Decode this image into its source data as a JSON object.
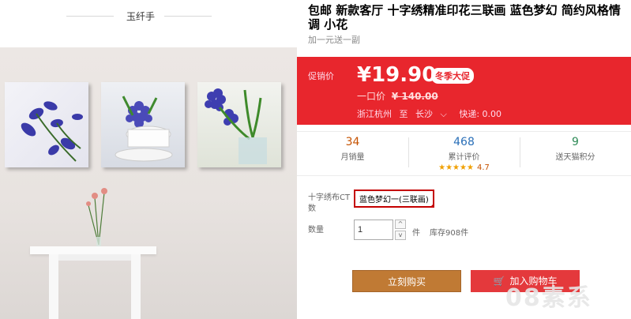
{
  "left": {
    "brand_name": "玉纤手"
  },
  "product": {
    "title": "包邮 新款客厅 十字绣精准印花三联画 蓝色梦幻 简约风格情调 小花",
    "subtitle": "加一元送一副"
  },
  "price": {
    "promo_label": "促销价",
    "current": "¥19.90",
    "promo_badge": "冬季大促",
    "orig_label": "一口价",
    "orig_value": "¥ 140.00",
    "ship_from": "浙江杭州",
    "to_label": "至",
    "ship_to": "长沙",
    "shipping": "快递: 0.00"
  },
  "stats": [
    {
      "value": "34",
      "label": "月销量"
    },
    {
      "value": "468",
      "label": "累计评价",
      "stars": "★★★★★",
      "score": "4.7"
    },
    {
      "value": "9",
      "label": "送天猫积分"
    }
  ],
  "options": {
    "label": "十字绣布CT数",
    "selected": "蓝色梦幻一(三联画)"
  },
  "quantity": {
    "label": "数量",
    "value": "1",
    "unit": "件",
    "stock": "库存908件",
    "up_icon": "^",
    "down_icon": "v"
  },
  "actions": {
    "buy": "立刻购买",
    "cart": "加入购物车",
    "cart_icon": "🛒"
  },
  "watermark": {
    "text": "08素系"
  },
  "colors": {
    "price_bg": "#e8262d",
    "buy_bg": "#c07a34",
    "cart_bg": "#e4393c"
  }
}
